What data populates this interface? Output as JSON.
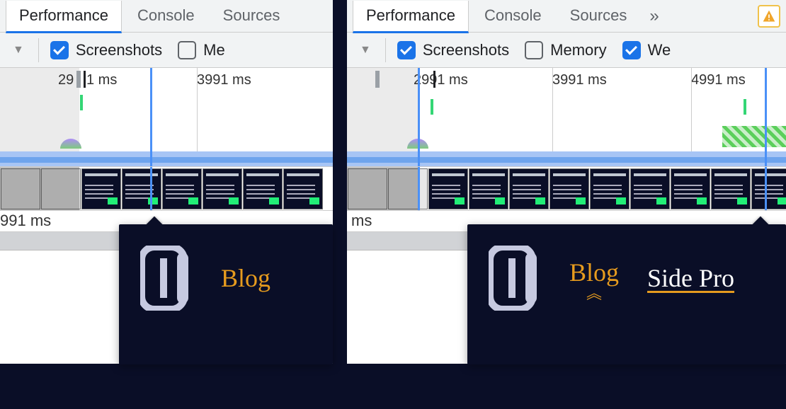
{
  "tabs": {
    "performance": "Performance",
    "console": "Console",
    "sources": "Sources",
    "overflow_glyph": "»"
  },
  "toolbar": {
    "screenshots": "Screenshots",
    "memory_short": "Me",
    "memory": "Memory",
    "webvitals_short": "We"
  },
  "left_overview": {
    "tick_partial_left": "29",
    "tick_1": "1 ms",
    "tick_3991": "3991 ms"
  },
  "left_ruler": {
    "label_991": "991 ms"
  },
  "right_overview": {
    "tick_2991": "2991 ms",
    "tick_3991": "3991 ms",
    "tick_4991": "4991 ms"
  },
  "right_ruler": {
    "label_ms": "ms"
  },
  "popup": {
    "blog": "Blog",
    "side_pro": "Side Pro"
  },
  "icons": {
    "warning": "warning",
    "caret": "▼",
    "chevrons": "︽"
  }
}
